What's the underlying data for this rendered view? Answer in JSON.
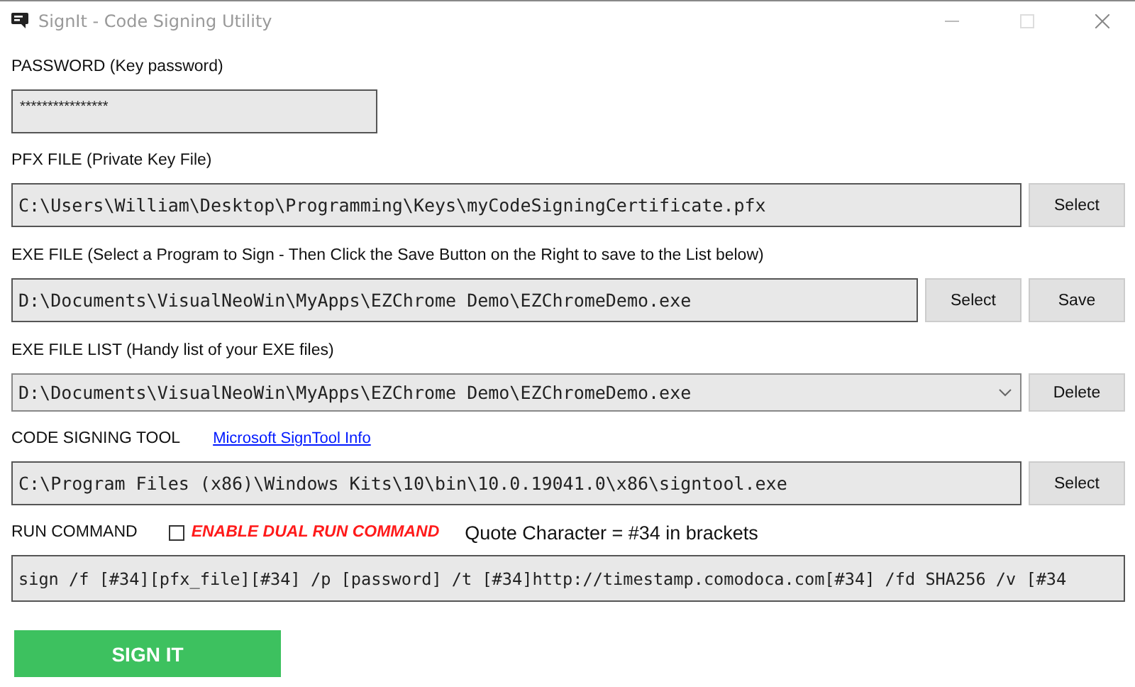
{
  "window": {
    "title": "SignIt - Code Signing Utility"
  },
  "password": {
    "label": "PASSWORD (Key password)",
    "value": "****************"
  },
  "pfx_file": {
    "label": "PFX FILE  (Private Key File)",
    "value": "C:\\Users\\William\\Desktop\\Programming\\Keys\\myCodeSigningCertificate.pfx",
    "buttons": [
      "Select"
    ]
  },
  "exe_file": {
    "label": "EXE FILE   (Select a Program to Sign - Then Click the Save Button on the Right to save to the List below)",
    "value": "D:\\Documents\\VisualNeoWin\\MyApps\\EZChrome Demo\\EZChromeDemo.exe",
    "buttons": [
      "Select",
      "Save"
    ]
  },
  "exe_file_list": {
    "label": "EXE FILE LIST  (Handy list of your EXE files)",
    "value": "D:\\Documents\\VisualNeoWin\\MyApps\\EZChrome Demo\\EZChromeDemo.exe",
    "buttons": [
      "Delete"
    ]
  },
  "code_signing_tool": {
    "label": "CODE SIGNING TOOL",
    "link": "Microsoft SignTool Info",
    "value": "C:\\Program Files (x86)\\Windows Kits\\10\\bin\\10.0.19041.0\\x86\\signtool.exe",
    "buttons": [
      "Select"
    ]
  },
  "run_command": {
    "label": "RUN COMMAND",
    "dual_run": {
      "label": "ENABLE DUAL RUN COMMAND",
      "checked": false
    },
    "note": "Quote Character = #34 in brackets",
    "value": "sign /f [#34][pfx_file][#34] /p [password] /t [#34]http://timestamp.comodoca.com[#34] /fd SHA256 /v [#34"
  },
  "sign_button": "SIGN IT"
}
